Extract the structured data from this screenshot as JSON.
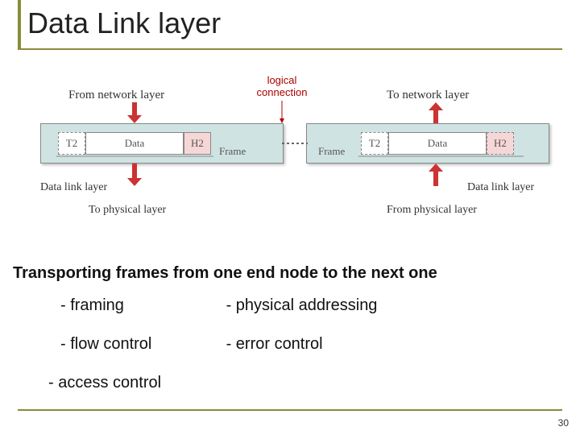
{
  "title": "Data Link layer",
  "diagram": {
    "logical_label_line1": "logical",
    "logical_label_line2": "connection",
    "left": {
      "top_label": "From network layer",
      "t2": "T2",
      "data": "Data",
      "h2": "H2",
      "frame_label": "Frame",
      "side_label": "Data link layer",
      "bottom_label": "To physical layer"
    },
    "right": {
      "top_label": "To network layer",
      "t2": "T2",
      "data": "Data",
      "h2": "H2",
      "frame_label": "Frame",
      "side_label": "Data link layer",
      "bottom_label": "From physical layer"
    }
  },
  "subhead": "Transporting frames from one end node to the next one",
  "bullets": {
    "framing": "- framing",
    "physical": "- physical addressing",
    "flow": "- flow control",
    "error": "- error control",
    "access": "- access control"
  },
  "page_num": "30"
}
